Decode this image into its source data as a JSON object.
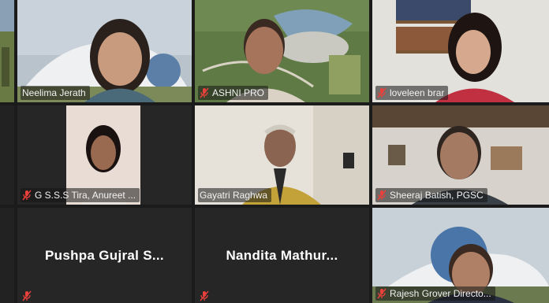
{
  "tiles": [
    {
      "name": "Neelima Jerath",
      "muted": false
    },
    {
      "name": "ASHNI PRO",
      "muted": true
    },
    {
      "name": "loveleen brar",
      "muted": true
    },
    {
      "name": "G S.S.S Tira,  Anureet ...",
      "muted": true
    },
    {
      "name": "Gayatri Raghwa",
      "muted": false
    },
    {
      "name": "Sheeraj Batish, PGSC",
      "muted": true
    },
    {
      "name": "Pushpa Gujral S...",
      "muted": true
    },
    {
      "name": "Nandita  Mathur...",
      "muted": true
    },
    {
      "name": "Rajesh Grover Directo...",
      "muted": true
    }
  ],
  "icons": {
    "mic_muted": "mic-muted-icon"
  },
  "colors": {
    "muted_red": "#e8403a",
    "active_speaker": "#c8d24b",
    "background": "#1b1b1b",
    "tile": "#262626"
  }
}
